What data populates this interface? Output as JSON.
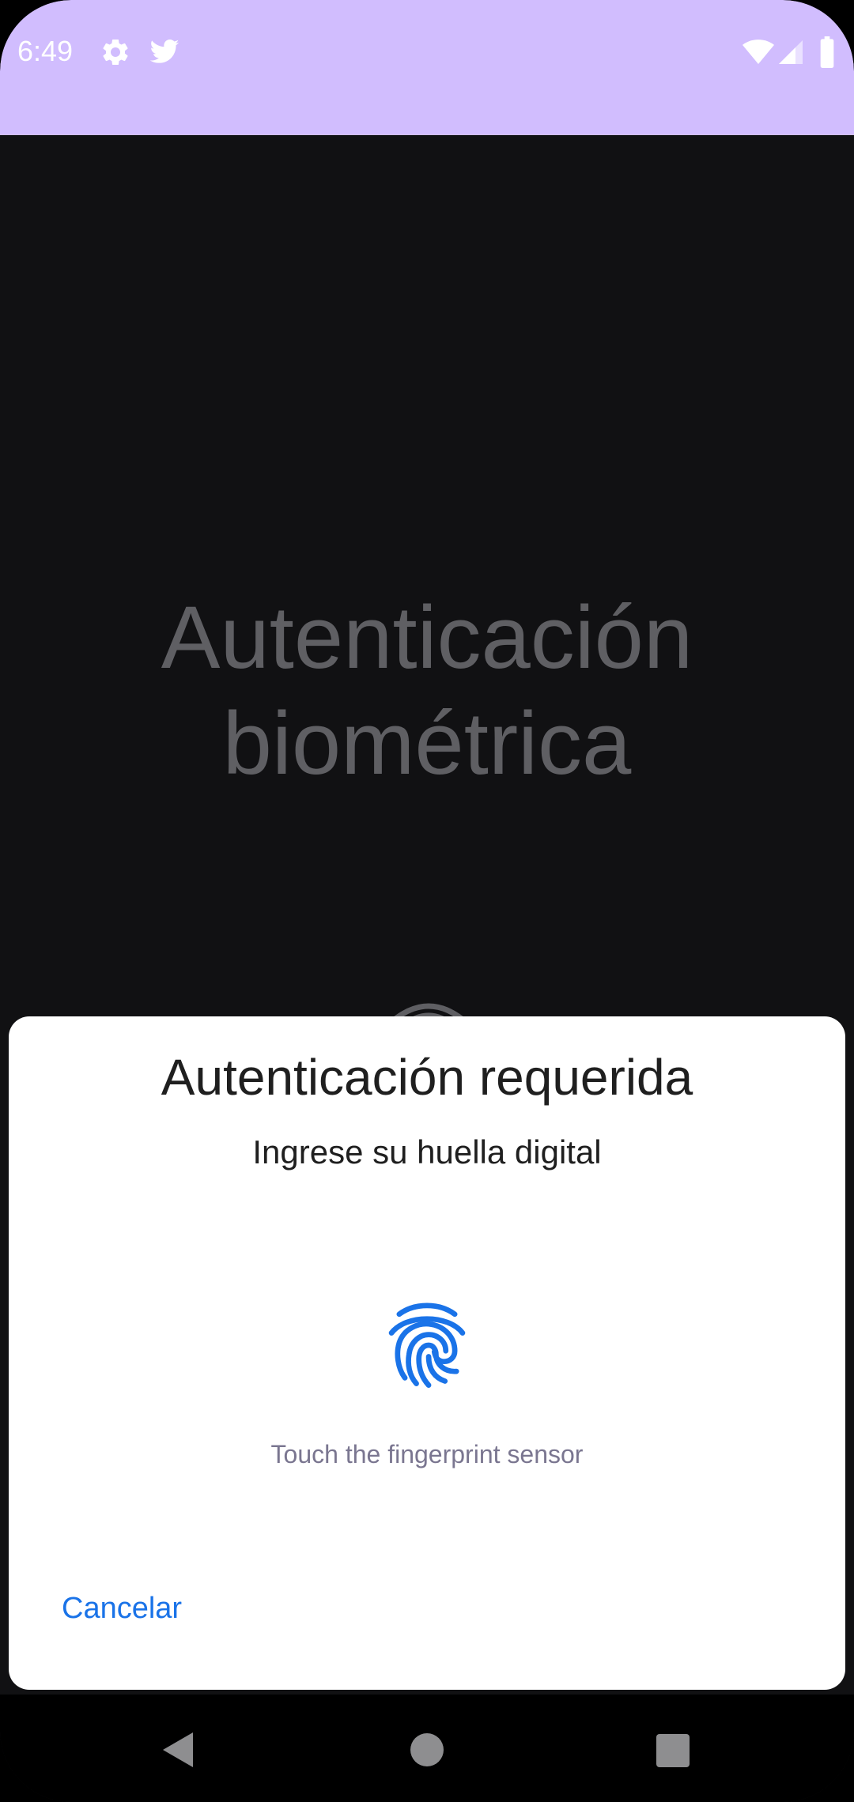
{
  "status_bar": {
    "time": "6:49",
    "background_color": "#d1bdfe",
    "left_icons": [
      "settings-icon",
      "twitter-icon"
    ],
    "right_icons": [
      "wifi-icon",
      "cellular-signal-icon",
      "battery-icon"
    ]
  },
  "background_screen": {
    "title": "Autenticación biométrica",
    "background_color": "#111113",
    "title_color": "#5f5f63"
  },
  "dialog": {
    "title": "Autenticación requerida",
    "subtitle": "Ingrese su huella digital",
    "icon": "fingerprint-icon",
    "icon_color": "#1a73e8",
    "hint": "Touch the fingerprint sensor",
    "cancel_label": "Cancelar"
  },
  "nav_bar": {
    "buttons": [
      "back-icon",
      "home-icon",
      "recents-icon"
    ]
  }
}
